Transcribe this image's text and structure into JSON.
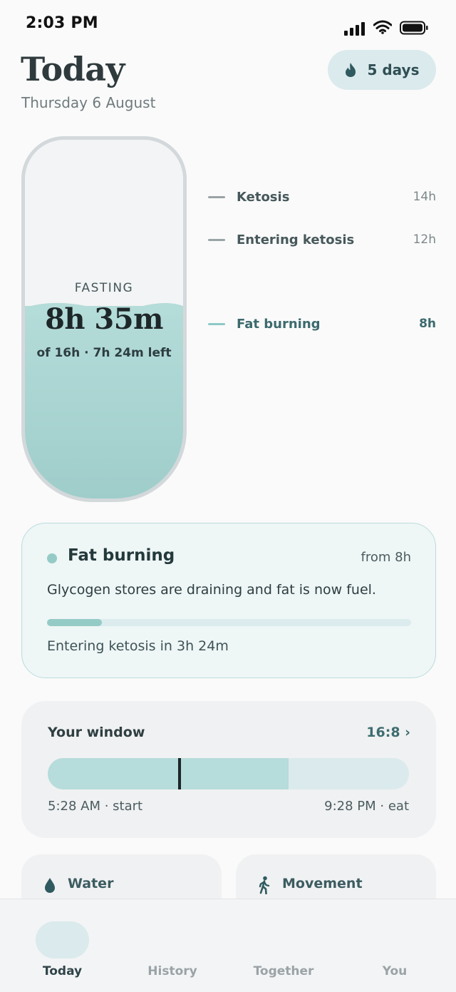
{
  "status_bar": {
    "time": "2:03 PM"
  },
  "header": {
    "title": "Today",
    "date": "Thursday 6 August",
    "streak_label": "5 days"
  },
  "fasting": {
    "label": "FASTING",
    "elapsed": "8h 35m",
    "summary": "of 16h · 7h 24m left",
    "progress_fraction": 0.537
  },
  "stages": [
    {
      "name": "Ketosis",
      "hours": "14h",
      "active": false
    },
    {
      "name": "Entering ketosis",
      "hours": "12h",
      "active": false
    },
    {
      "name": "Fat burning",
      "hours": "8h",
      "active": true
    }
  ],
  "phase_card": {
    "title": "Fat burning",
    "from": "from 8h",
    "description": "Glycogen stores are draining and fat is now fuel.",
    "progress_fraction": 0.15,
    "next": "Entering ketosis in 3h 24m"
  },
  "window_card": {
    "title": "Your window",
    "ratio": "16:8 ›",
    "fast_fraction": 0.667,
    "now_fraction": 0.36,
    "start_label": "5:28 AM · start",
    "end_label": "9:28 PM · eat"
  },
  "mini_cards": {
    "water_label": "Water",
    "movement_label": "Movement"
  },
  "tabs": [
    {
      "label": "Today",
      "active": true
    },
    {
      "label": "History",
      "active": false
    },
    {
      "label": "Together",
      "active": false
    },
    {
      "label": "You",
      "active": false
    }
  ],
  "colors": {
    "accent": "#95cbc7",
    "accent_dark": "#3e6d70",
    "pill_bg": "#dbeaec"
  },
  "icons": [
    "signal-icon",
    "wifi-icon",
    "battery-icon",
    "flame-icon",
    "water-drop-icon",
    "walking-person-icon"
  ]
}
